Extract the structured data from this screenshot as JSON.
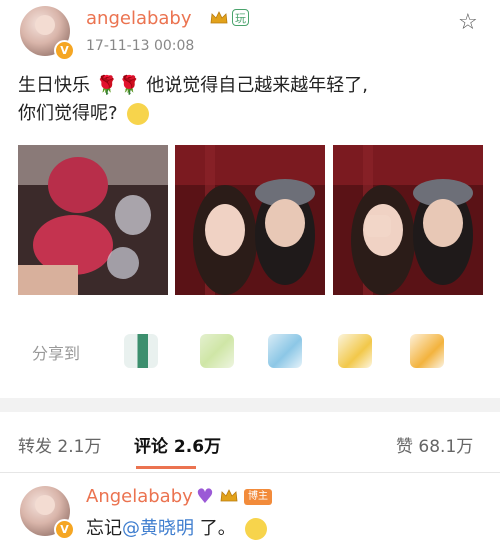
{
  "post": {
    "username": "angelababy",
    "timestamp": "17-11-13 00:08",
    "vip_badge_text": "V",
    "tag_text": "玩",
    "text_line1": "生日快乐 🌹🌹 他说觉得自己越来越年轻了,",
    "text_line2": "你们觉得呢?"
  },
  "photos": [
    {
      "name": "wine-glasses-photo"
    },
    {
      "name": "selfie-photo-1"
    },
    {
      "name": "selfie-photo-2"
    }
  ],
  "share": {
    "label": "分享到",
    "targets": [
      "wechat-icon",
      "moments-icon",
      "qq-icon",
      "qzone-icon",
      "other-share-icon"
    ]
  },
  "stats": {
    "repost_label": "转发",
    "repost_count": "2.1万",
    "comment_label": "评论",
    "comment_count": "2.6万",
    "like_label": "赞",
    "like_count": "68.1万"
  },
  "comment": {
    "username": "Angelababy",
    "role_badge": "博主",
    "text_before": "忘记",
    "mention": "@黄晓明",
    "text_after": " 了。"
  },
  "colors": {
    "accent": "#eb7350",
    "mention": "#3f7ecf",
    "tag_green": "#4aa36c"
  }
}
